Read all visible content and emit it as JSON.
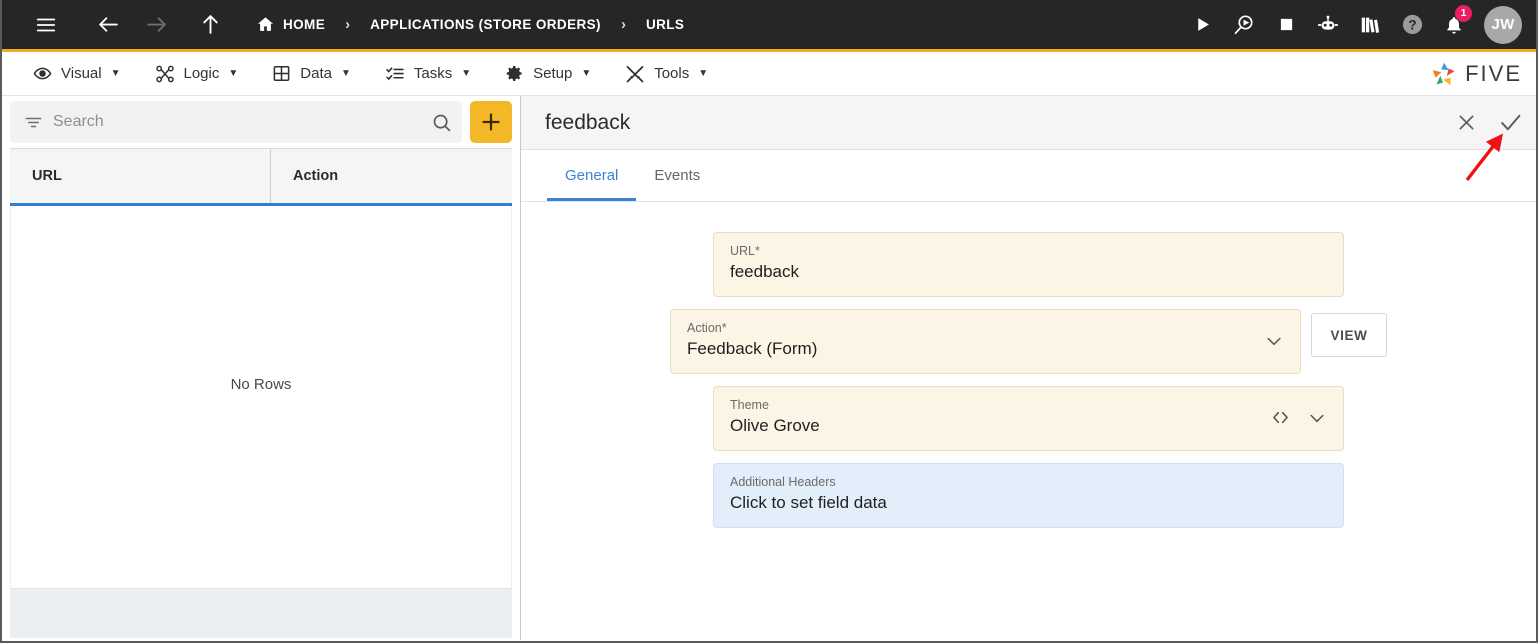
{
  "topbar": {
    "nav_icons": [
      {
        "name": "hamburger-menu-icon",
        "label": "menu"
      },
      {
        "name": "back-arrow-icon",
        "label": "back"
      },
      {
        "name": "forward-arrow-icon",
        "label": "forward"
      },
      {
        "name": "up-arrow-icon",
        "label": "up"
      }
    ],
    "breadcrumbs": [
      {
        "label": "HOME",
        "icon": "home-icon"
      },
      {
        "label": "APPLICATIONS (STORE ORDERS)",
        "icon": ""
      },
      {
        "label": "URLS",
        "icon": ""
      }
    ],
    "separator": "›",
    "right_icons": [
      {
        "name": "play-icon",
        "label": "Run"
      },
      {
        "name": "debug-search-icon",
        "label": "Debug"
      },
      {
        "name": "stop-icon",
        "label": "Stop"
      },
      {
        "name": "robot-chat-icon",
        "label": "Assistant"
      },
      {
        "name": "books-library-icon",
        "label": "Library"
      },
      {
        "name": "help-circle-icon",
        "label": "Help"
      },
      {
        "name": "bell-notification-icon",
        "label": "Notifications"
      }
    ],
    "notification_count": "1",
    "avatar_initials": "JW",
    "colors": {
      "bar_bg": "#262626",
      "accent_underline": "#f0ad20",
      "badge": "#e91e63"
    }
  },
  "menubar": {
    "items": [
      {
        "label": "Visual",
        "icon": "eye-icon",
        "caret": "▼"
      },
      {
        "label": "Logic",
        "icon": "nodes-icon",
        "caret": "▼"
      },
      {
        "label": "Data",
        "icon": "grid-table-icon",
        "caret": "▼"
      },
      {
        "label": "Tasks",
        "icon": "checklist-icon",
        "caret": "▼"
      },
      {
        "label": "Setup",
        "icon": "gear-icon",
        "caret": "▼"
      },
      {
        "label": "Tools",
        "icon": "tools-cross-icon",
        "caret": "▼"
      }
    ],
    "brand": "FIVE"
  },
  "left_panel": {
    "search": {
      "placeholder": "Search",
      "value": "",
      "filter_icon": "filter-icon",
      "search_icon": "search-icon"
    },
    "add_button_label": "+",
    "grid": {
      "columns": [
        "URL",
        "Action"
      ],
      "rows": [],
      "empty_message": "No Rows"
    }
  },
  "right_panel": {
    "title": "feedback",
    "close_icon": "close-x-icon",
    "save_icon": "checkmark-icon",
    "tabs": [
      {
        "label": "General",
        "active": true
      },
      {
        "label": "Events",
        "active": false
      }
    ],
    "fields": [
      {
        "label": "URL",
        "required": "*",
        "value": "feedback",
        "style": "cream",
        "icons": [],
        "side_button": null
      },
      {
        "label": "Action",
        "required": "*",
        "value": "Feedback (Form)",
        "style": "cream",
        "icons": [
          "chevron-down-icon"
        ],
        "side_button": "VIEW"
      },
      {
        "label": "Theme",
        "required": "",
        "value": "Olive Grove",
        "style": "cream",
        "icons": [
          "code-brackets-icon",
          "chevron-down-icon"
        ],
        "side_button": null
      },
      {
        "label": "Additional Headers",
        "required": "",
        "value": "Click to set field data",
        "style": "blue",
        "icons": [],
        "side_button": null
      }
    ]
  },
  "annotation": {
    "arrow_color": "#ee1111",
    "points_to": "save-checkmark-button"
  }
}
